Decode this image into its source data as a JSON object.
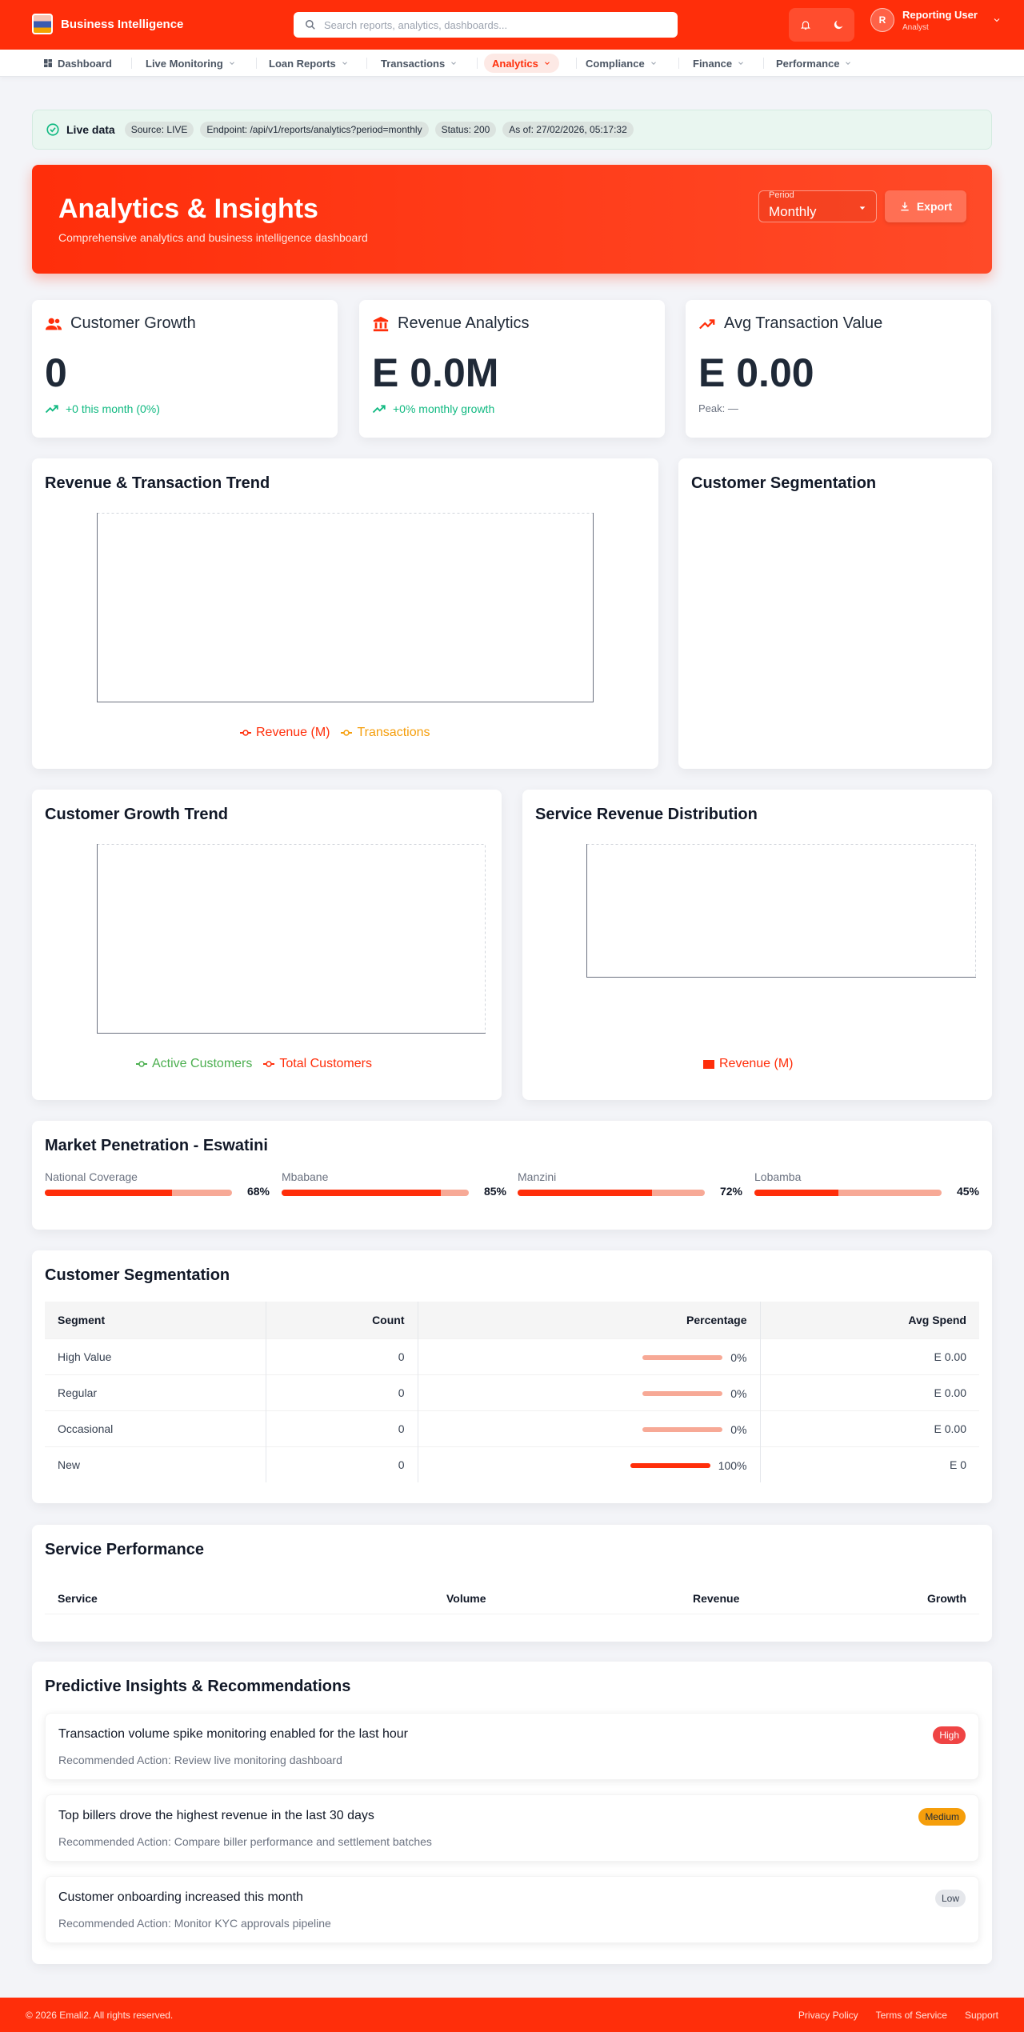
{
  "app": {
    "title": "Business Intelligence"
  },
  "search": {
    "placeholder": "Search reports, analytics, dashboards..."
  },
  "user": {
    "initial": "R",
    "name": "Reporting User",
    "role": "Analyst"
  },
  "nav": {
    "items": [
      {
        "label": "Dashboard"
      },
      {
        "label": "Live Monitoring"
      },
      {
        "label": "Loan Reports"
      },
      {
        "label": "Transactions"
      },
      {
        "label": "Analytics"
      },
      {
        "label": "Compliance"
      },
      {
        "label": "Finance"
      },
      {
        "label": "Performance"
      }
    ]
  },
  "live": {
    "label": "Live data",
    "source": "Source: LIVE",
    "endpoint": "Endpoint: /api/v1/reports/analytics?period=monthly",
    "status": "Status: 200",
    "as_of": "As of: 27/02/2026, 05:17:32"
  },
  "hero": {
    "title": "Analytics & Insights",
    "subtitle": "Comprehensive analytics and business intelligence dashboard",
    "period_label": "Period",
    "period_value": "Monthly",
    "export_label": "Export"
  },
  "stats": {
    "customer_growth": {
      "title": "Customer Growth",
      "value": "0",
      "trend": "+0 this month (0%)"
    },
    "revenue": {
      "title": "Revenue Analytics",
      "value": "E 0.0M",
      "trend": "+0% monthly growth"
    },
    "avg_tx": {
      "title": "Avg Transaction Value",
      "value": "E 0.00",
      "peak": "Peak: —"
    }
  },
  "charts": {
    "rev_trend": {
      "title": "Revenue & Transaction Trend",
      "legend_revenue": "Revenue (M)",
      "legend_tx": "Transactions"
    },
    "segmentation": {
      "title": "Customer Segmentation"
    },
    "growth_trend": {
      "title": "Customer Growth Trend",
      "legend_active": "Active Customers",
      "legend_total": "Total Customers"
    },
    "service_rev": {
      "title": "Service Revenue Distribution",
      "legend_revenue": "Revenue (M)"
    }
  },
  "market": {
    "title": "Market Penetration - Eswatini",
    "regions": [
      {
        "label": "National Coverage",
        "pct": 68,
        "pct_text": "68%"
      },
      {
        "label": "Mbabane",
        "pct": 85,
        "pct_text": "85%"
      },
      {
        "label": "Manzini",
        "pct": 72,
        "pct_text": "72%"
      },
      {
        "label": "Lobamba",
        "pct": 45,
        "pct_text": "45%"
      }
    ]
  },
  "segments": {
    "title": "Customer Segmentation",
    "headers": [
      "Segment",
      "Count",
      "Percentage",
      "Avg Spend"
    ],
    "rows": [
      {
        "segment": "High Value",
        "count": "0",
        "pct": 0,
        "pct_text": "0%",
        "avg": "E 0.00"
      },
      {
        "segment": "Regular",
        "count": "0",
        "pct": 0,
        "pct_text": "0%",
        "avg": "E 0.00"
      },
      {
        "segment": "Occasional",
        "count": "0",
        "pct": 0,
        "pct_text": "0%",
        "avg": "E 0.00"
      },
      {
        "segment": "New",
        "count": "0",
        "pct": 100,
        "pct_text": "100%",
        "avg": "E 0"
      }
    ]
  },
  "service_perf": {
    "title": "Service Performance",
    "headers": [
      "Service",
      "Volume",
      "Revenue",
      "Growth"
    ]
  },
  "insights": {
    "title": "Predictive Insights & Recommendations",
    "items": [
      {
        "title": "Transaction volume spike monitoring enabled for the last hour",
        "action": "Recommended Action: Review live monitoring dashboard",
        "priority": "High"
      },
      {
        "title": "Top billers drove the highest revenue in the last 30 days",
        "action": "Recommended Action: Compare biller performance and settlement batches",
        "priority": "Medium"
      },
      {
        "title": "Customer onboarding increased this month",
        "action": "Recommended Action: Monitor KYC approvals pipeline",
        "priority": "Low"
      }
    ]
  },
  "footer": {
    "copyright": "© 2026 Emali2. All rights reserved.",
    "links": [
      "Privacy Policy",
      "Terms of Service",
      "Support"
    ]
  },
  "colors": {
    "brand": "#ff2e0a",
    "success": "#10b981",
    "active_series": "#4caf50",
    "tx_series": "#f59e0b"
  }
}
